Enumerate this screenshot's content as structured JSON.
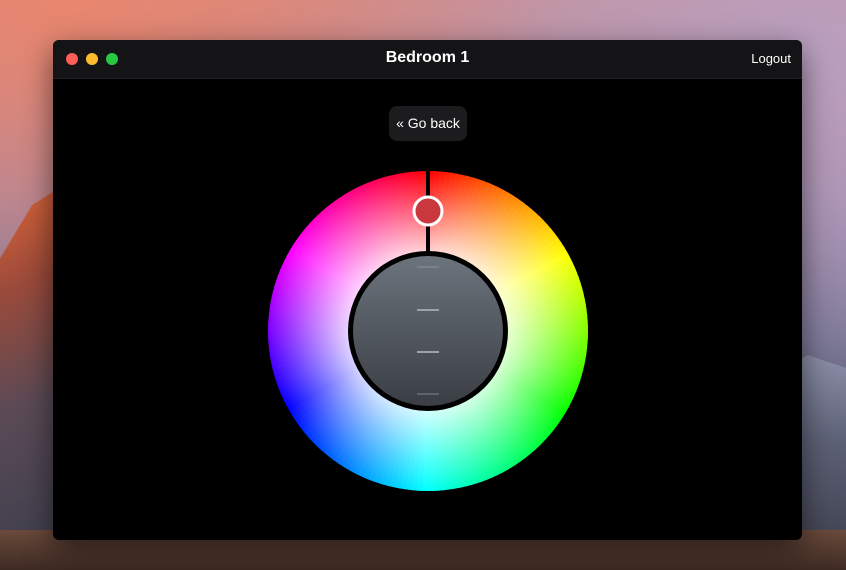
{
  "window": {
    "title": "Bedroom 1",
    "logout_label": "Logout"
  },
  "controls": {
    "go_back_label": "« Go back"
  },
  "color_picker": {
    "selected_color": "#c8383c",
    "selected_hue_deg": 0
  },
  "colors": {
    "traffic_close": "#fc5f57",
    "traffic_minimize": "#fdbc2e",
    "traffic_maximize": "#28c840"
  }
}
